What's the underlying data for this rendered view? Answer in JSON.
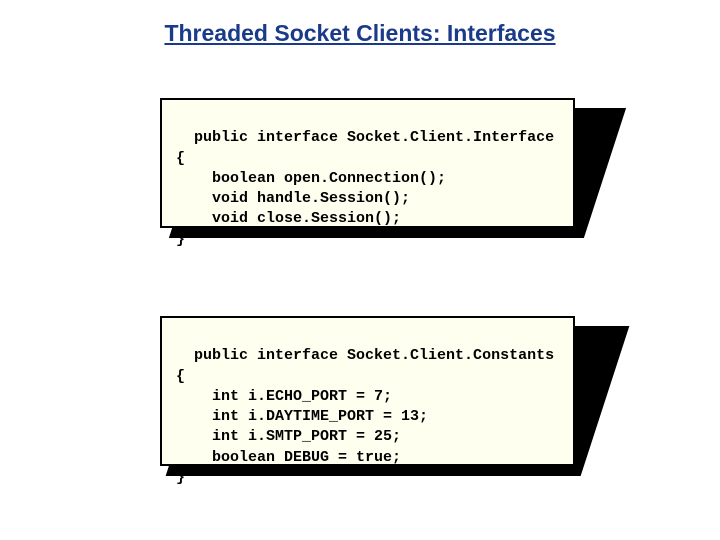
{
  "title": "Threaded Socket Clients: Interfaces",
  "blocks": [
    {
      "code": "public interface Socket.Client.Interface\n{\n    boolean open.Connection();\n    void handle.Session();\n    void close.Session();\n}"
    },
    {
      "code": "public interface Socket.Client.Constants\n{\n    int i.ECHO_PORT = 7;\n    int i.DAYTIME_PORT = 13;\n    int i.SMTP_PORT = 25;\n    boolean DEBUG = true;\n}"
    }
  ]
}
